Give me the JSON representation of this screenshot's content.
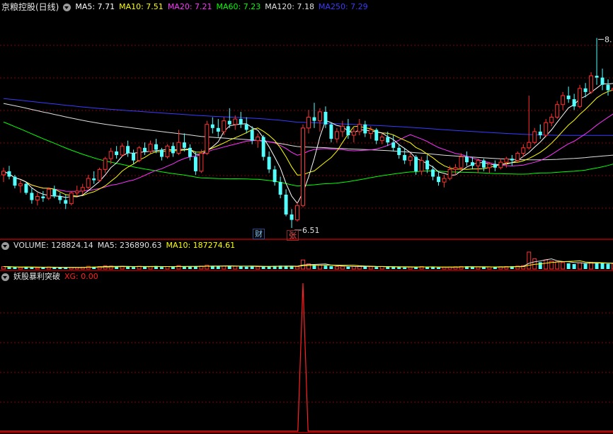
{
  "header": {
    "stock_name": "京粮控股(日线)",
    "ma": [
      {
        "text": "MA5: 7.71",
        "color": "#ffffff"
      },
      {
        "text": "MA10: 7.51",
        "color": "#ffff00"
      },
      {
        "text": "MA20: 7.21",
        "color": "#ff33ff"
      },
      {
        "text": "MA60: 7.23",
        "color": "#00ff00"
      },
      {
        "text": "MA120: 7.18",
        "color": "#e0e0e0"
      },
      {
        "text": "MA250: 7.29",
        "color": "#3a3aff"
      }
    ]
  },
  "volume_header": [
    {
      "text": "VOLUME: 128824.14",
      "color": "#e0e0e0"
    },
    {
      "text": "MA5: 236890.63",
      "color": "#e0e0e0"
    },
    {
      "text": "MA10: 187274.61",
      "color": "#ffff00"
    }
  ],
  "indicator_header": {
    "name": "妖股暴利突破",
    "value": {
      "text": "XG: 0.00",
      "color": "#ff2020"
    }
  },
  "annotations": {
    "low_label": "6.51",
    "high_label": "8.",
    "tag_cai": "财",
    "tag_zhang": "张"
  },
  "colors": {
    "up": "#ff3232",
    "down": "#54ffff",
    "grid": "#8b0000",
    "border": "#b00000",
    "signal": "#ff2020"
  },
  "chart_data": {
    "type": "candlestick",
    "candles": [
      [
        7.1,
        7.18,
        7.02,
        7.14
      ],
      [
        7.14,
        7.2,
        7.05,
        7.08
      ],
      [
        7.08,
        7.1,
        6.95,
        6.98
      ],
      [
        6.98,
        7.04,
        6.9,
        7.0
      ],
      [
        7.0,
        7.02,
        6.88,
        6.9
      ],
      [
        6.9,
        6.95,
        6.78,
        6.82
      ],
      [
        6.82,
        6.9,
        6.76,
        6.86
      ],
      [
        6.86,
        6.92,
        6.8,
        6.84
      ],
      [
        6.84,
        6.96,
        6.82,
        6.94
      ],
      [
        6.94,
        6.98,
        6.84,
        6.86
      ],
      [
        6.86,
        6.9,
        6.78,
        6.82
      ],
      [
        6.82,
        6.88,
        6.72,
        6.78
      ],
      [
        6.78,
        6.92,
        6.76,
        6.9
      ],
      [
        6.9,
        6.98,
        6.86,
        6.92
      ],
      [
        6.92,
        7.0,
        6.88,
        6.96
      ],
      [
        6.96,
        7.1,
        6.94,
        7.06
      ],
      [
        7.06,
        7.14,
        7.0,
        7.04
      ],
      [
        7.04,
        7.18,
        7.02,
        7.16
      ],
      [
        7.16,
        7.3,
        7.12,
        7.28
      ],
      [
        7.28,
        7.4,
        7.22,
        7.36
      ],
      [
        7.36,
        7.42,
        7.28,
        7.32
      ],
      [
        7.32,
        7.45,
        7.3,
        7.42
      ],
      [
        7.42,
        7.48,
        7.3,
        7.34
      ],
      [
        7.34,
        7.38,
        7.22,
        7.26
      ],
      [
        7.26,
        7.42,
        7.24,
        7.4
      ],
      [
        7.4,
        7.46,
        7.32,
        7.36
      ],
      [
        7.36,
        7.48,
        7.34,
        7.44
      ],
      [
        7.44,
        7.5,
        7.34,
        7.38
      ],
      [
        7.38,
        7.4,
        7.26,
        7.3
      ],
      [
        7.3,
        7.44,
        7.28,
        7.42
      ],
      [
        7.42,
        7.46,
        7.3,
        7.34
      ],
      [
        7.34,
        7.6,
        7.32,
        7.46
      ],
      [
        7.46,
        7.56,
        7.36,
        7.4
      ],
      [
        7.4,
        7.44,
        7.26,
        7.3
      ],
      [
        7.3,
        7.36,
        7.1,
        7.14
      ],
      [
        7.14,
        7.38,
        7.12,
        7.34
      ],
      [
        7.34,
        7.7,
        7.32,
        7.66
      ],
      [
        7.66,
        7.74,
        7.56,
        7.62
      ],
      [
        7.62,
        7.72,
        7.52,
        7.58
      ],
      [
        7.58,
        7.74,
        7.54,
        7.7
      ],
      [
        7.7,
        7.84,
        7.62,
        7.66
      ],
      [
        7.66,
        7.76,
        7.6,
        7.72
      ],
      [
        7.72,
        7.8,
        7.62,
        7.66
      ],
      [
        7.66,
        7.74,
        7.56,
        7.6
      ],
      [
        7.6,
        7.64,
        7.44,
        7.48
      ],
      [
        7.48,
        7.56,
        7.4,
        7.52
      ],
      [
        7.52,
        7.54,
        7.26,
        7.3
      ],
      [
        7.3,
        7.36,
        7.12,
        7.16
      ],
      [
        7.16,
        7.2,
        6.98,
        7.02
      ],
      [
        7.02,
        7.08,
        6.84,
        6.88
      ],
      [
        6.88,
        6.94,
        6.64,
        6.66
      ],
      [
        6.66,
        6.72,
        6.51,
        6.6
      ],
      [
        6.6,
        6.8,
        6.58,
        6.76
      ],
      [
        6.76,
        7.66,
        6.74,
        7.62
      ],
      [
        7.62,
        7.82,
        7.56,
        7.74
      ],
      [
        7.74,
        7.9,
        7.62,
        7.7
      ],
      [
        7.7,
        7.84,
        7.58,
        7.8
      ],
      [
        7.8,
        7.86,
        7.62,
        7.66
      ],
      [
        7.66,
        7.68,
        7.46,
        7.5
      ],
      [
        7.5,
        7.62,
        7.46,
        7.58
      ],
      [
        7.58,
        7.7,
        7.52,
        7.64
      ],
      [
        7.64,
        7.72,
        7.5,
        7.54
      ],
      [
        7.54,
        7.62,
        7.46,
        7.58
      ],
      [
        7.58,
        7.72,
        7.54,
        7.66
      ],
      [
        7.66,
        7.7,
        7.52,
        7.56
      ],
      [
        7.56,
        7.64,
        7.5,
        7.6
      ],
      [
        7.6,
        7.62,
        7.44,
        7.48
      ],
      [
        7.48,
        7.56,
        7.44,
        7.52
      ],
      [
        7.52,
        7.58,
        7.42,
        7.46
      ],
      [
        7.46,
        7.54,
        7.36,
        7.4
      ],
      [
        7.4,
        7.44,
        7.28,
        7.32
      ],
      [
        7.32,
        7.4,
        7.22,
        7.26
      ],
      [
        7.26,
        7.34,
        7.2,
        7.3
      ],
      [
        7.3,
        7.32,
        7.1,
        7.14
      ],
      [
        7.14,
        7.3,
        7.1,
        7.26
      ],
      [
        7.26,
        7.32,
        7.12,
        7.16
      ],
      [
        7.16,
        7.2,
        7.04,
        7.08
      ],
      [
        7.08,
        7.14,
        6.98,
        7.02
      ],
      [
        7.02,
        7.1,
        6.96,
        7.06
      ],
      [
        7.06,
        7.2,
        7.04,
        7.16
      ],
      [
        7.16,
        7.22,
        7.1,
        7.18
      ],
      [
        7.18,
        7.34,
        7.14,
        7.3
      ],
      [
        7.3,
        7.36,
        7.2,
        7.24
      ],
      [
        7.24,
        7.3,
        7.16,
        7.2
      ],
      [
        7.2,
        7.28,
        7.12,
        7.26
      ],
      [
        7.26,
        7.28,
        7.14,
        7.18
      ],
      [
        7.18,
        7.24,
        7.12,
        7.22
      ],
      [
        7.22,
        7.26,
        7.14,
        7.18
      ],
      [
        7.18,
        7.28,
        7.16,
        7.24
      ],
      [
        7.24,
        7.3,
        7.18,
        7.28
      ],
      [
        7.28,
        7.32,
        7.2,
        7.26
      ],
      [
        7.26,
        7.36,
        7.24,
        7.34
      ],
      [
        7.34,
        7.44,
        7.3,
        7.4
      ],
      [
        7.4,
        7.98,
        7.38,
        7.46
      ],
      [
        7.46,
        7.62,
        7.44,
        7.58
      ],
      [
        7.58,
        7.66,
        7.5,
        7.54
      ],
      [
        7.54,
        7.72,
        7.52,
        7.68
      ],
      [
        7.68,
        7.78,
        7.64,
        7.74
      ],
      [
        7.74,
        7.92,
        7.72,
        7.88
      ],
      [
        7.88,
        8.02,
        7.82,
        7.98
      ],
      [
        7.98,
        8.08,
        7.9,
        7.94
      ],
      [
        7.94,
        8.0,
        7.82,
        7.86
      ],
      [
        7.86,
        8.1,
        7.84,
        8.06
      ],
      [
        8.06,
        8.12,
        7.96,
        8.02
      ],
      [
        8.02,
        8.24,
        8.0,
        8.2
      ],
      [
        8.2,
        8.62,
        8.1,
        8.18
      ],
      [
        8.18,
        8.28,
        8.04,
        8.1
      ],
      [
        8.1,
        8.16,
        7.98,
        8.04
      ],
      [
        8.04,
        8.2,
        8.0,
        8.06
      ]
    ],
    "volume": [
      22,
      18,
      16,
      14,
      20,
      15,
      12,
      14,
      18,
      16,
      13,
      12,
      15,
      14,
      16,
      24,
      20,
      22,
      28,
      26,
      22,
      24,
      20,
      18,
      24,
      20,
      22,
      26,
      18,
      22,
      20,
      30,
      24,
      20,
      22,
      26,
      34,
      28,
      24,
      26,
      30,
      24,
      22,
      20,
      26,
      20,
      22,
      24,
      28,
      30,
      26,
      22,
      20,
      80,
      46,
      36,
      34,
      30,
      26,
      22,
      24,
      20,
      22,
      26,
      24,
      20,
      18,
      22,
      20,
      18,
      16,
      14,
      18,
      20,
      22,
      20,
      16,
      14,
      16,
      18,
      20,
      22,
      24,
      20,
      18,
      16,
      18,
      16,
      20,
      22,
      24,
      26,
      30,
      150,
      90,
      60,
      80,
      70,
      64,
      58,
      50,
      44,
      56,
      48,
      60,
      54,
      50,
      46,
      48
    ],
    "xg_signal_index": 53,
    "xg_peak": 1.0,
    "price_range": [
      6.4,
      8.9
    ],
    "ma_periods": [
      5,
      10,
      20,
      60,
      120,
      250
    ]
  }
}
